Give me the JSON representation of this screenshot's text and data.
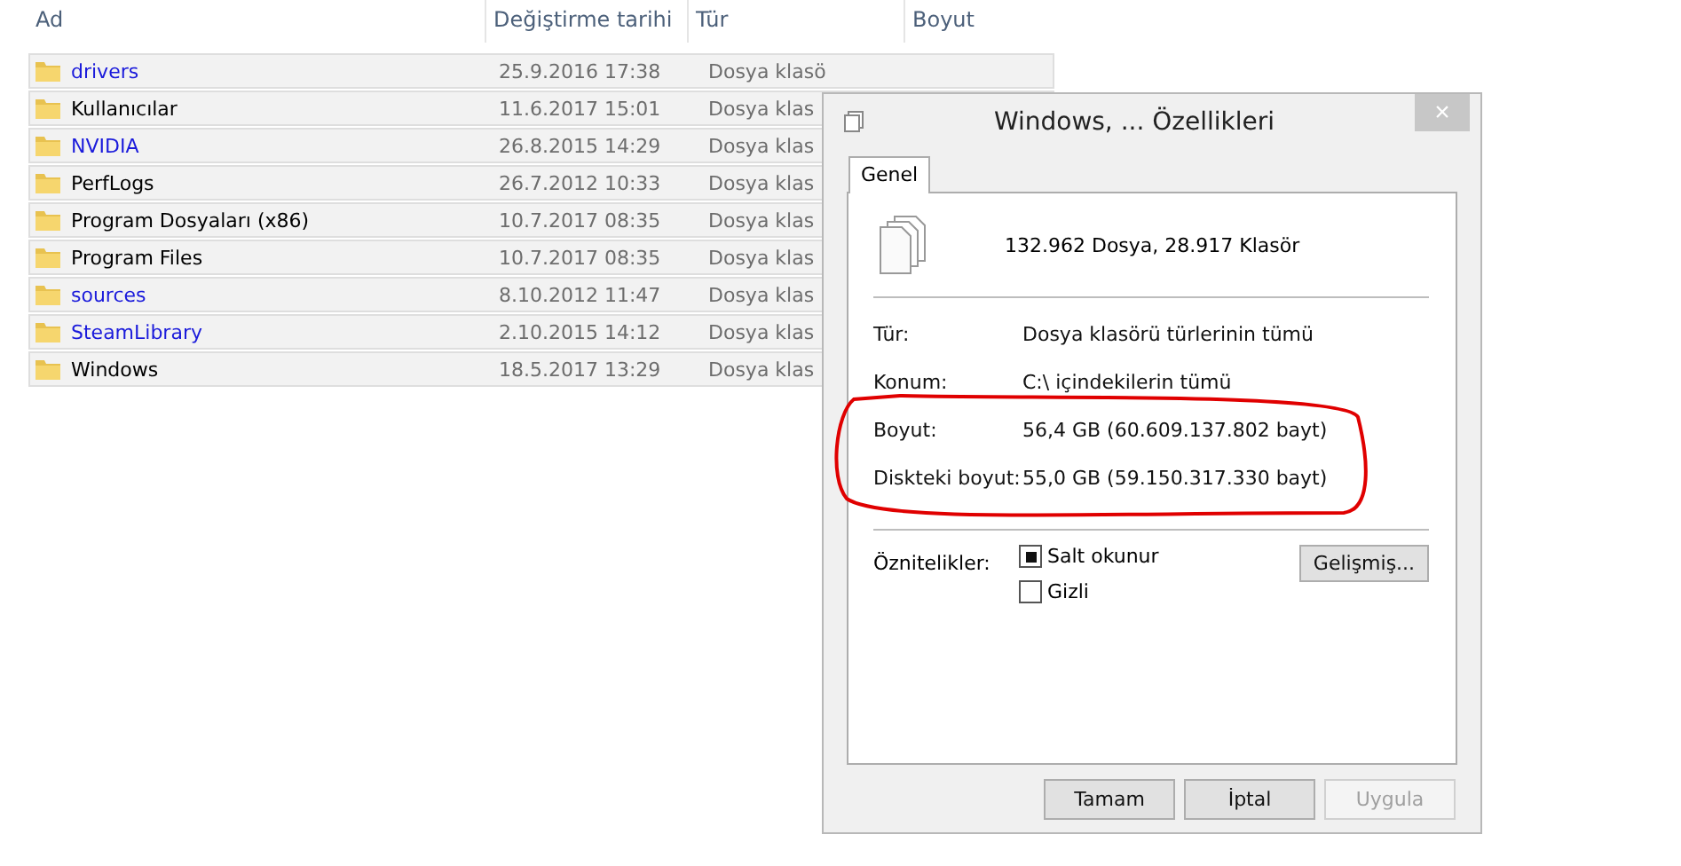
{
  "file_list": {
    "columns": [
      "Ad",
      "Değiştirme tarihi",
      "Tür",
      "Boyut"
    ],
    "rows": [
      {
        "name": "drivers",
        "color": "#1a1adb",
        "modified": "25.9.2016 17:38",
        "type": "Dosya klasö",
        "selected": true
      },
      {
        "name": "Kullanıcılar",
        "color": "#000000",
        "modified": "11.6.2017 15:01",
        "type": "Dosya klas",
        "selected": true
      },
      {
        "name": "NVIDIA",
        "color": "#1a1adb",
        "modified": "26.8.2015 14:29",
        "type": "Dosya klas",
        "selected": true
      },
      {
        "name": "PerfLogs",
        "color": "#000000",
        "modified": "26.7.2012 10:33",
        "type": "Dosya klas",
        "selected": true
      },
      {
        "name": "Program Dosyaları (x86)",
        "color": "#000000",
        "modified": "10.7.2017 08:35",
        "type": "Dosya klas",
        "selected": true
      },
      {
        "name": "Program Files",
        "color": "#000000",
        "modified": "10.7.2017 08:35",
        "type": "Dosya klas",
        "selected": true
      },
      {
        "name": "sources",
        "color": "#1a1adb",
        "modified": "8.10.2012 11:47",
        "type": "Dosya klas",
        "selected": true
      },
      {
        "name": "SteamLibrary",
        "color": "#1a1adb",
        "modified": "2.10.2015 14:12",
        "type": "Dosya klas",
        "selected": true
      },
      {
        "name": "Windows",
        "color": "#000000",
        "modified": "18.5.2017 13:29",
        "type": "Dosya klas",
        "selected": true
      }
    ]
  },
  "dialog": {
    "title": "Windows, ... Özellikleri",
    "close": "×",
    "tabs": [
      {
        "label": "Genel",
        "selected": true
      }
    ],
    "summary": "132.962 Dosya, 28.917 Klasör",
    "properties": [
      {
        "label": "Tür:",
        "value": "Dosya klasörü türlerinin tümü"
      },
      {
        "label": "Konum:",
        "value": "C:\\ içindekilerin tümü"
      },
      {
        "label": "Boyut:",
        "value": "56,4 GB (60.609.137.802 bayt)"
      },
      {
        "label": "Diskteki boyut:",
        "value": "55,0 GB (59.150.317.330 bayt)"
      }
    ],
    "attributes_label": "Öznitelikler:",
    "attributes": [
      {
        "label": "Salt okunur",
        "checked": true
      },
      {
        "label": "Gizli",
        "checked": false
      }
    ],
    "advanced_button": "Gelişmiş...",
    "buttons": [
      {
        "label": "Tamam",
        "disabled": false
      },
      {
        "label": "İptal",
        "disabled": false
      },
      {
        "label": "Uygula",
        "disabled": true
      }
    ]
  }
}
